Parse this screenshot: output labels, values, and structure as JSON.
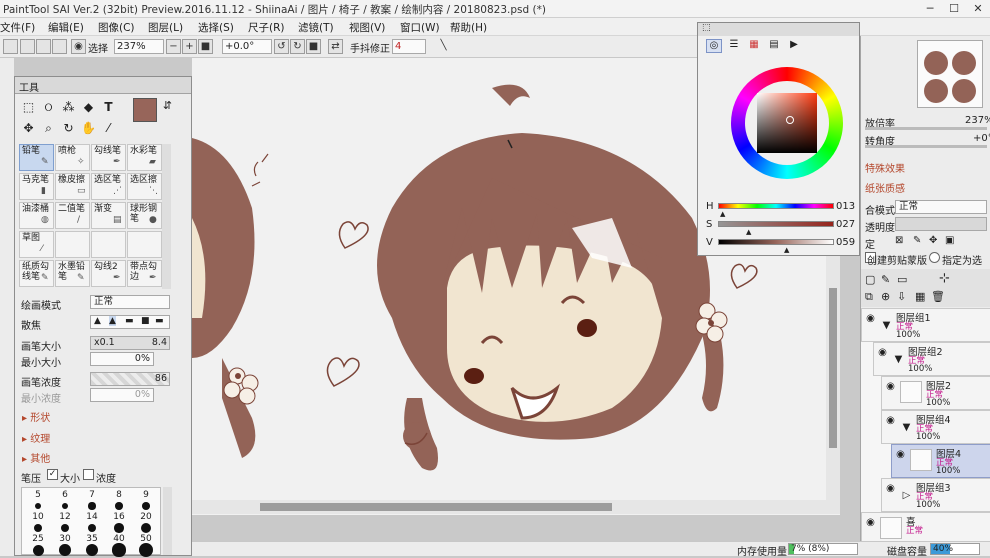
{
  "titlebar": {
    "title": "PaintTool SAI Ver.2 (32bit) Preview.2016.11.12 - ShiinaAi / 图片 / 椅子 / 教案 / 绘制内容 / 20180823.psd (*)",
    "min": "─",
    "max": "☐",
    "close": "✕"
  },
  "menus": [
    "文件(F)",
    "编辑(E)",
    "图像(C)",
    "图层(L)",
    "选择(S)",
    "尺子(R)",
    "滤镜(T)",
    "视图(V)",
    "窗口(W)",
    "帮助(H)"
  ],
  "toolbar": {
    "select_label": "选择",
    "zoom": "237%",
    "angle": "+0.0°",
    "stabilizer_label": "手抖修正",
    "stabilizer_value": "4"
  },
  "tool_panel": {
    "title": "工具",
    "brushes": [
      {
        "name": "铅笔",
        "icon": "pencil-icon",
        "glyph": "✎"
      },
      {
        "name": "喷枪",
        "icon": "airbrush-icon",
        "glyph": "✧"
      },
      {
        "name": "勾线笔",
        "icon": "pen-icon",
        "glyph": "✒"
      },
      {
        "name": "水彩笔",
        "icon": "watercolor-icon",
        "glyph": "▰"
      },
      {
        "name": "马克笔",
        "icon": "marker-icon",
        "glyph": "▮"
      },
      {
        "name": "橡皮擦",
        "icon": "eraser-icon",
        "glyph": "▭"
      },
      {
        "name": "选区笔",
        "icon": "select-pen-icon",
        "glyph": "⋰"
      },
      {
        "name": "选区擦",
        "icon": "select-eraser-icon",
        "glyph": "⋱"
      },
      {
        "name": "油漆桶",
        "icon": "bucket-icon",
        "glyph": "◍"
      },
      {
        "name": "二值笔",
        "icon": "binary-pen-icon",
        "glyph": "/"
      },
      {
        "name": "渐变",
        "icon": "gradient-icon",
        "glyph": "▤"
      },
      {
        "name": "球形钢笔",
        "icon": "ball-pen-icon",
        "glyph": "●"
      },
      {
        "name": "草图",
        "icon": "sketch-icon",
        "glyph": "⁄"
      },
      {
        "name": "",
        "icon": "",
        "glyph": ""
      },
      {
        "name": "",
        "icon": "",
        "glyph": ""
      },
      {
        "name": "",
        "icon": "",
        "glyph": ""
      },
      {
        "name": "纸质勾线笔",
        "icon": "paper-pen-icon",
        "glyph": "✎"
      },
      {
        "name": "水墨铅笔",
        "icon": "ink-pencil-icon",
        "glyph": "✎"
      },
      {
        "name": "勾线2",
        "icon": "line-pen-icon",
        "glyph": "✒"
      },
      {
        "name": "带点勾边",
        "icon": "dot-pen-icon",
        "glyph": "✒"
      }
    ],
    "draw_mode_label": "绘画模式",
    "draw_mode_value": "正常",
    "blur_label": "散焦",
    "brush_size_label": "画笔大小",
    "brush_size_mult": "x0.1",
    "brush_size_value": "8.4",
    "min_size_label": "最小大小",
    "min_size_value": "0%",
    "brush_density_label": "画笔浓度",
    "brush_density_value": "86",
    "min_density_label": "最小浓度",
    "min_density_value": "0%",
    "sections": [
      "▸ 形状",
      "▸ 纹理",
      "▸ 其他"
    ],
    "pressure_label": "笔压",
    "pressure_size": "大小",
    "pressure_density": "浓度",
    "size_presets_row1": [
      "5",
      "6",
      "7",
      "8",
      "9"
    ],
    "size_presets_row2": [
      "10",
      "12",
      "14",
      "16",
      "20"
    ],
    "size_presets_row3": [
      "25",
      "30",
      "35",
      "40",
      "50"
    ]
  },
  "color_panel": {
    "h_label": "H",
    "h_value": "013",
    "s_label": "S",
    "s_value": "027",
    "v_label": "V",
    "v_value": "059",
    "current_color": "#97655a"
  },
  "right_panel": {
    "zoom_label": "放倍率",
    "zoom_value": "237%",
    "angle_label": "转角度",
    "angle_value": "+0°",
    "effect_label": "特殊效果",
    "paper_label": "纸张质感",
    "blend_label": "合模式",
    "blend_value": "正常",
    "opacity_label": "透明度",
    "lock_label": "定",
    "clip_label": "创建剪贴蒙版",
    "select_source_label": "指定为选区样",
    "layers": [
      {
        "name": "图层组1",
        "mode": "正常",
        "opacity": "100%"
      },
      {
        "name": "图层组2",
        "mode": "正常",
        "opacity": "100%"
      },
      {
        "name": "图层2",
        "mode": "正常",
        "opacity": "100%"
      },
      {
        "name": "图层组4",
        "mode": "正常",
        "opacity": "100%"
      },
      {
        "name": "图层4",
        "mode": "正常",
        "opacity": "100%"
      },
      {
        "name": "图层组3",
        "mode": "正常",
        "opacity": "100%"
      },
      {
        "name": "喜",
        "mode": "正常",
        "opacity": ""
      }
    ]
  },
  "status": {
    "memory_label": "内存使用量",
    "memory_value": "7% (8%)",
    "disk_label": "磁盘容量",
    "disk_value": "40%"
  },
  "colors": {
    "line": "#7b4438",
    "hair": "#936357",
    "skin": "#f1e5d0",
    "cheek": "#5b1f12"
  }
}
